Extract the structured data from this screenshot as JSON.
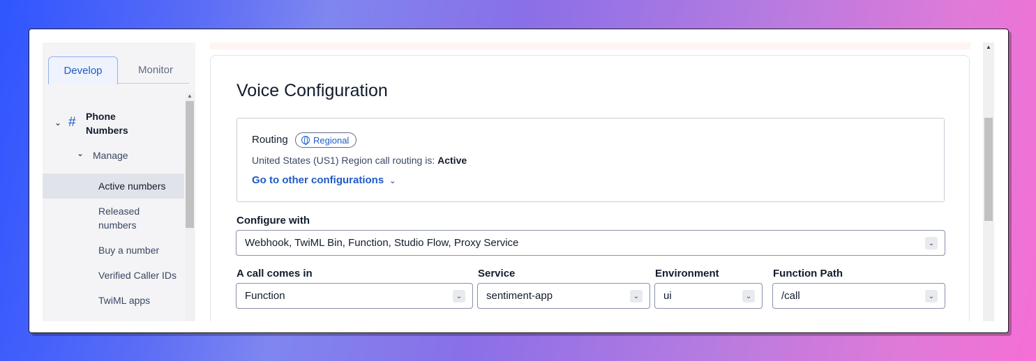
{
  "sidebar": {
    "tabs": [
      {
        "label": "Develop"
      },
      {
        "label": "Monitor"
      }
    ],
    "section": {
      "label": "Phone Numbers"
    },
    "group": {
      "label": "Manage"
    },
    "items": [
      {
        "label": "Active numbers"
      },
      {
        "label": "Released numbers"
      },
      {
        "label": "Buy a number"
      },
      {
        "label": "Verified Caller IDs"
      },
      {
        "label": "TwiML apps"
      }
    ]
  },
  "main": {
    "title": "Voice Configuration",
    "routing": {
      "label": "Routing",
      "badge": "Regional",
      "description_prefix": "United States (US1) Region call routing is: ",
      "status": "Active",
      "link": "Go to other configurations"
    },
    "configure_with": {
      "label": "Configure with",
      "value": "Webhook, TwiML Bin, Function, Studio Flow, Proxy Service"
    },
    "fields": [
      {
        "label": "A call comes in",
        "value": "Function"
      },
      {
        "label": "Service",
        "value": "sentiment-app"
      },
      {
        "label": "Environment",
        "value": "ui"
      },
      {
        "label": "Function Path",
        "value": "/call"
      }
    ]
  },
  "colors": {
    "accent": "#1f5bc7",
    "text": "#121c2d",
    "border": "#8891aa"
  },
  "icons": {
    "section": "hash-icon",
    "badge": "globe-icon",
    "expand": "chevron-down-icon"
  }
}
